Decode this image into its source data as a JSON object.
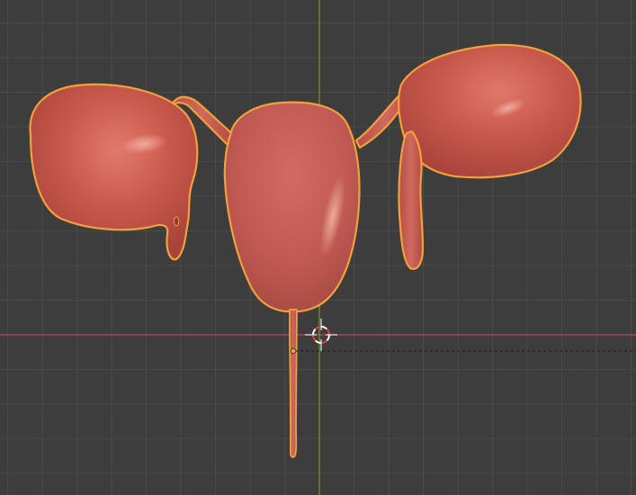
{
  "app": "3D viewport",
  "viewport": {
    "background": "#3d3d3d",
    "grid_color": "#4a4a4a",
    "x_axis_color": "#b8484f",
    "y_axis_color": "#6e9a37",
    "selection_outline_color": "#f2a03c"
  },
  "scene": {
    "selected_object": "uterus-model",
    "mesh_color": "#c5584d",
    "icons": {
      "cursor": "3d-cursor-icon",
      "origin": "object-origin-icon"
    }
  }
}
